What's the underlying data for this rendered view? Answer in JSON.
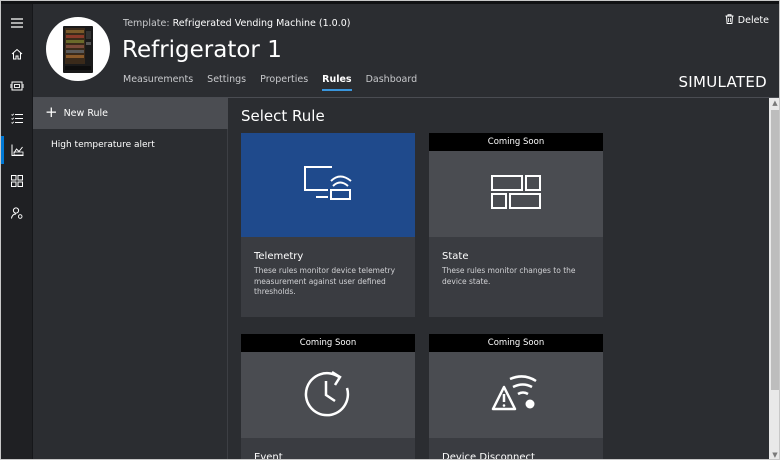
{
  "header": {
    "template_label": "Template:",
    "template_value": "Refrigerated Vending Machine (1.0.0)",
    "device_name": "Refrigerator 1",
    "delete_label": "Delete",
    "status": "SIMULATED",
    "tabs": [
      {
        "label": "Measurements",
        "active": false
      },
      {
        "label": "Settings",
        "active": false
      },
      {
        "label": "Properties",
        "active": false
      },
      {
        "label": "Rules",
        "active": true
      },
      {
        "label": "Dashboard",
        "active": false
      }
    ]
  },
  "rail": {
    "items": [
      "menu-icon",
      "home-icon",
      "device-icon",
      "checklist-icon",
      "analytics-icon",
      "dashboard-grid-icon",
      "admin-user-icon"
    ],
    "active": "analytics-icon"
  },
  "rules_panel": {
    "new_rule_label": "New Rule",
    "items": [
      "High temperature alert"
    ]
  },
  "main": {
    "title": "Select Rule",
    "cards": [
      {
        "title": "Telemetry",
        "description": "These rules monitor device telemetry measurement against user defined thresholds.",
        "badge": "",
        "icon": "telemetry-icon"
      },
      {
        "title": "State",
        "description": "These rules monitor changes to the device state.",
        "badge": "Coming Soon",
        "icon": "state-icon"
      },
      {
        "title": "Event",
        "description": "",
        "badge": "Coming Soon",
        "icon": "event-icon"
      },
      {
        "title": "Device Disconnect",
        "description": "",
        "badge": "Coming Soon",
        "icon": "device-disconnect-icon"
      }
    ]
  },
  "colors": {
    "background": "#2b2d31",
    "rail": "#1f2023",
    "accent_tab": "#3a96dd",
    "telemetry_card": "#1f4a8c",
    "card_visual": "#4a4c51",
    "badge_band": "#000000"
  }
}
